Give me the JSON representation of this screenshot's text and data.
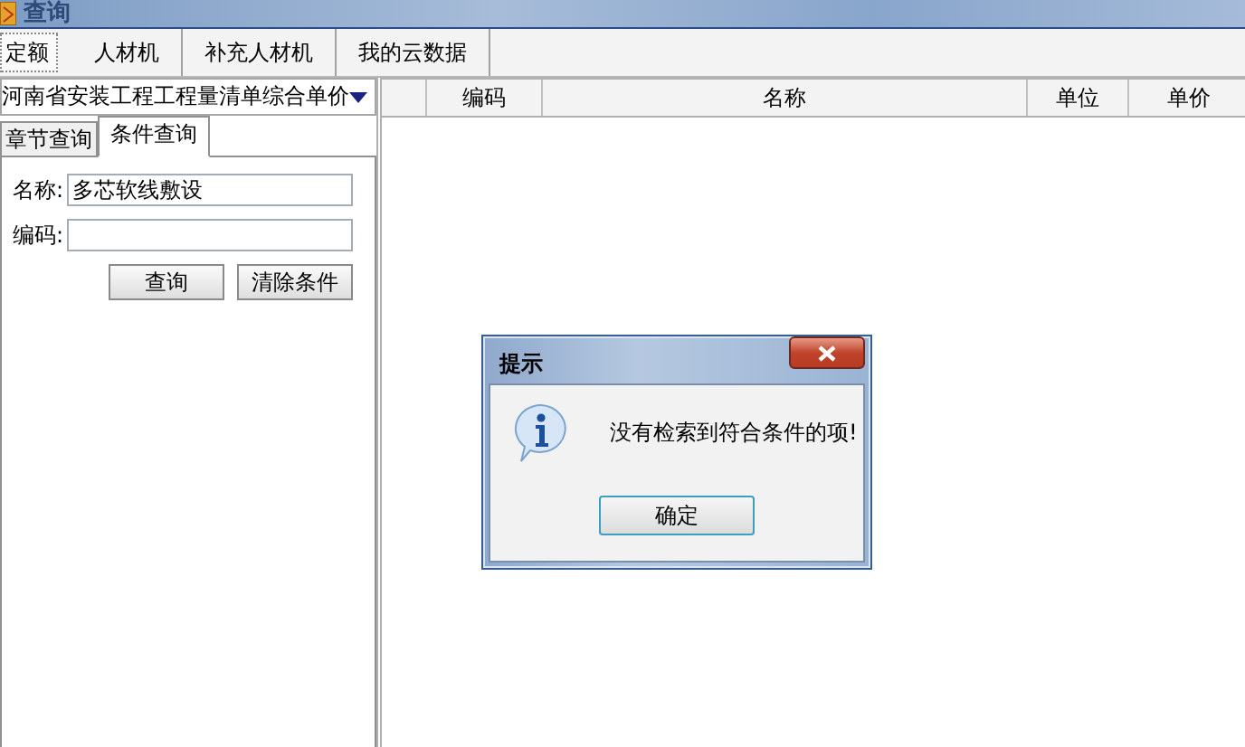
{
  "window": {
    "title": "查询"
  },
  "tabs": [
    {
      "label": "定额",
      "selected": true
    },
    {
      "label": "人材机",
      "selected": false
    },
    {
      "label": "补充人材机",
      "selected": false
    },
    {
      "label": "我的云数据",
      "selected": false
    }
  ],
  "library_select": {
    "value": "河南省安装工程工程量清单综合单价"
  },
  "sub_tabs": [
    {
      "label": "章节查询",
      "selected": false
    },
    {
      "label": "条件查询",
      "selected": true
    }
  ],
  "form": {
    "fields": [
      {
        "label": "名称:",
        "value": "多芯软线敷设"
      },
      {
        "label": "编码:"
      }
    ],
    "buttons": [
      "查询",
      "清除条件"
    ]
  },
  "table": {
    "columns": [
      "",
      "编码",
      "名称",
      "单位",
      "单价"
    ]
  },
  "dialog": {
    "title": "提示",
    "message": "没有检索到符合条件的项!",
    "button": "确定"
  }
}
